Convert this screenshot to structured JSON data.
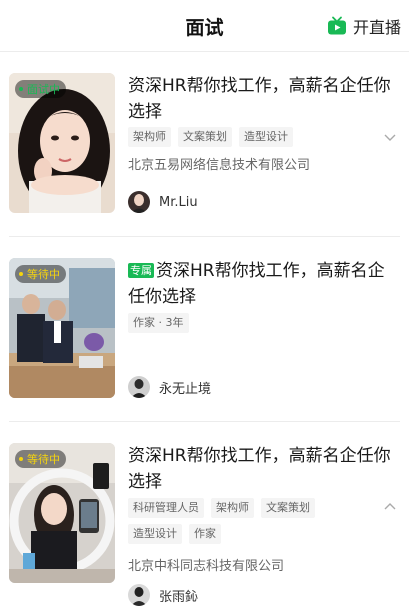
{
  "header": {
    "title": "面试",
    "live_label": "开直播"
  },
  "cards": [
    {
      "status": "面试中",
      "exclusive": "",
      "title": "资深HR帮你找工作，高薪名企任你选择",
      "tags": [
        "架构师",
        "文案策划",
        "造型设计"
      ],
      "company": "北京五易网络信息技术有限公司",
      "person": "Mr.Liu"
    },
    {
      "status": "等待中",
      "exclusive": "专属",
      "title": "资深HR帮你找工作，高薪名企任你选择",
      "tags": [
        "作家 · 3年"
      ],
      "company": "",
      "person": "永无止境"
    },
    {
      "status": "等待中",
      "exclusive": "",
      "title": "资深HR帮你找工作，高薪名企任你选择",
      "tags": [
        "科研管理人员",
        "架构师",
        "文案策划",
        "造型设计",
        "作家"
      ],
      "company": "北京中科同志科技有限公司",
      "person": "张雨鈊"
    }
  ],
  "colors": {
    "accent": "#19b955",
    "status_live": "#19b955",
    "status_wait": "#f5d40e"
  },
  "icons": {
    "live": "tv-icon",
    "expand": "chevron-down-icon",
    "collapse": "chevron-up-icon"
  }
}
